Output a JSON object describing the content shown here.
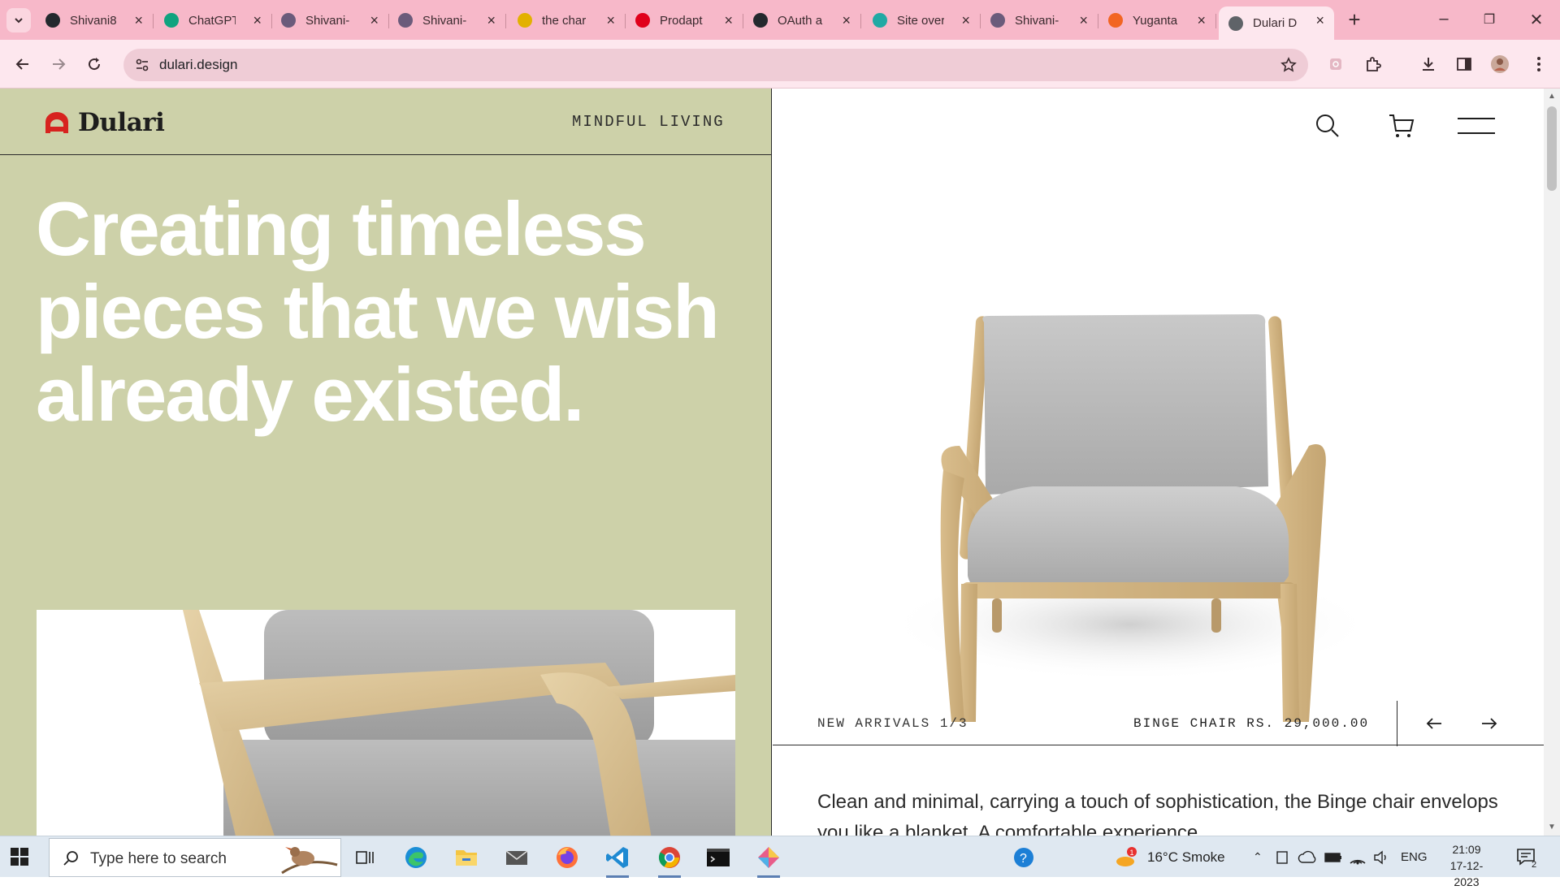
{
  "browser": {
    "tabs": [
      {
        "title": "Shivani8",
        "favicon": "github-icon",
        "color": "#24292e"
      },
      {
        "title": "ChatGPT",
        "favicon": "chatgpt-icon",
        "color": "#10a37f"
      },
      {
        "title": "Shivani-",
        "favicon": "page-icon",
        "color": "#6b5b7b"
      },
      {
        "title": "Shivani-",
        "favicon": "page-icon",
        "color": "#6b5b7b"
      },
      {
        "title": "the char",
        "favicon": "video-icon",
        "color": "#e2b100"
      },
      {
        "title": "Prodapt",
        "favicon": "prodapt-icon",
        "color": "#e0001b"
      },
      {
        "title": "OAuth a",
        "favicon": "github-icon",
        "color": "#24292e"
      },
      {
        "title": "Site over",
        "favicon": "netlify-icon",
        "color": "#20a9a4"
      },
      {
        "title": "Shivani-",
        "favicon": "page-icon",
        "color": "#6b5b7b"
      },
      {
        "title": "Yuganta",
        "favicon": "y-icon",
        "color": "#f26522"
      },
      {
        "title": "Dulari D",
        "favicon": "globe-icon",
        "color": "#5f6368",
        "active": true
      }
    ],
    "url": "dulari.design"
  },
  "site": {
    "brand": "Dulari",
    "brand_color": "#d7231f",
    "tagline": "MINDFUL LIVING",
    "headline": "Creating timeless pieces that we wish already existed.",
    "arrivals": "NEW ARRIVALS 1/3",
    "product_price": "BINGE CHAIR RS. 29,000.00",
    "description": "Clean and minimal, carrying a touch of sophistication, the Binge chair envelops you like a blanket. A comfortable experience",
    "left_bg": "#cdd1a9"
  },
  "taskbar": {
    "search_placeholder": "Type here to search",
    "weather": "16°C  Smoke",
    "notification_count": "1",
    "language": "ENG",
    "time": "21:09",
    "date": "17-12-2023",
    "action_center_count": "2"
  }
}
